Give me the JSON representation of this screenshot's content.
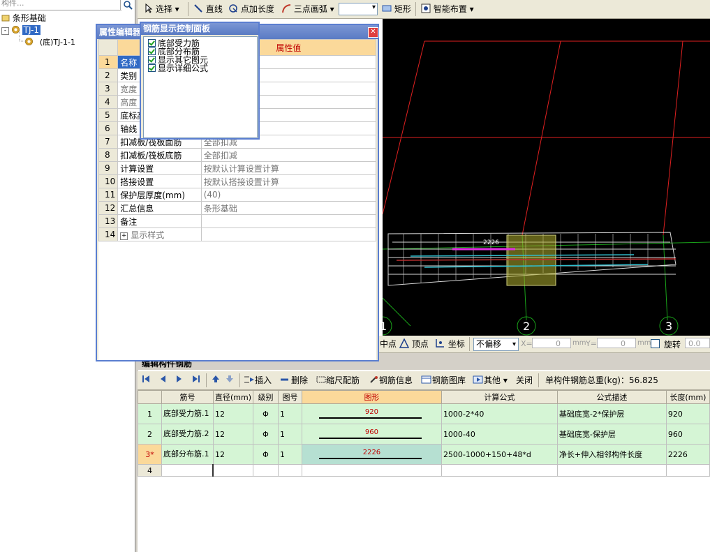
{
  "tree": {
    "search_placeholder": "构件...",
    "root_label": "条形基础",
    "node_label": "TJ-1",
    "child_label": "(底)TJ-1-1"
  },
  "toolbar": {
    "select": "选择",
    "line": "直线",
    "point_length": "点加长度",
    "three_point_arc": "三点画弧",
    "rect": "矩形",
    "smart_layout": "智能布置"
  },
  "prop_panel": {
    "title": "属性编辑器",
    "header_value": "属性值",
    "rows": [
      {
        "num": "1",
        "name": "名称",
        "value": ""
      },
      {
        "num": "2",
        "name": "类别",
        "value": ""
      },
      {
        "num": "3",
        "name": "宽度",
        "value": ""
      },
      {
        "num": "4",
        "name": "高度",
        "value": ""
      },
      {
        "num": "5",
        "name": "底标高",
        "value": ""
      },
      {
        "num": "6",
        "name": "轴线",
        "value": ""
      },
      {
        "num": "7",
        "name": "扣减板/筏板面筋",
        "value": "全部扣减"
      },
      {
        "num": "8",
        "name": "扣减板/筏板底筋",
        "value": "全部扣减"
      },
      {
        "num": "9",
        "name": "计算设置",
        "value": "按默认计算设置计算"
      },
      {
        "num": "10",
        "name": "搭接设置",
        "value": "按默认搭接设置计算"
      },
      {
        "num": "11",
        "name": "保护层厚度(mm)",
        "value": "(40)"
      },
      {
        "num": "12",
        "name": "汇总信息",
        "value": "条形基础"
      },
      {
        "num": "13",
        "name": "备注",
        "value": ""
      },
      {
        "num": "14",
        "name": "显示样式",
        "value": ""
      }
    ]
  },
  "rebar_panel": {
    "title": "钢筋显示控制面板",
    "options": [
      "底部受力筋",
      "底部分布筋",
      "显示其它图元",
      "显示详细公式"
    ]
  },
  "viewport": {
    "dim_label": "2226",
    "axis_labels": [
      "1",
      "2",
      "3"
    ]
  },
  "snapbar": {
    "midpoint": "中点",
    "vertex": "顶点",
    "coord": "坐标",
    "offset_mode": "不偏移",
    "x_label": "X=",
    "x_value": "0",
    "y_label": "Y=",
    "y_value": "0",
    "unit": "mm",
    "rotate": "旋转",
    "rotate_value": "0.0"
  },
  "editor": {
    "title": "编辑构件钢筋",
    "insert": "插入",
    "delete": "删除",
    "scale_rebar": "缩尺配筋",
    "rebar_info": "钢筋信息",
    "rebar_library": "钢筋图库",
    "other": "其他",
    "close": "关闭",
    "total_weight": "单构件钢筋总重(kg)：56.825",
    "columns": [
      "筋号",
      "直径(mm)",
      "级别",
      "图号",
      "图形",
      "计算公式",
      "公式描述",
      "长度(mm)"
    ],
    "rows": [
      {
        "num": "1",
        "name": "底部受力筋.1",
        "dia": "12",
        "grade": "Φ",
        "fig": "1",
        "shape": "920",
        "formula": "1000-2*40",
        "desc": "基础底宽-2*保护层",
        "length": "920"
      },
      {
        "num": "2",
        "name": "底部受力筋.2",
        "dia": "12",
        "grade": "Φ",
        "fig": "1",
        "shape": "960",
        "formula": "1000-40",
        "desc": "基础底宽-保护层",
        "length": "960"
      },
      {
        "num": "3*",
        "name": "底部分布筋.1",
        "dia": "12",
        "grade": "Φ",
        "fig": "1",
        "shape": "2226",
        "formula": "2500-1000+150+48*d",
        "desc": "净长+伸入相邻构件长度",
        "length": "2226"
      },
      {
        "num": "4",
        "name": "",
        "dia": "",
        "grade": "",
        "fig": "",
        "shape": "",
        "formula": "",
        "desc": "",
        "length": ""
      }
    ]
  }
}
